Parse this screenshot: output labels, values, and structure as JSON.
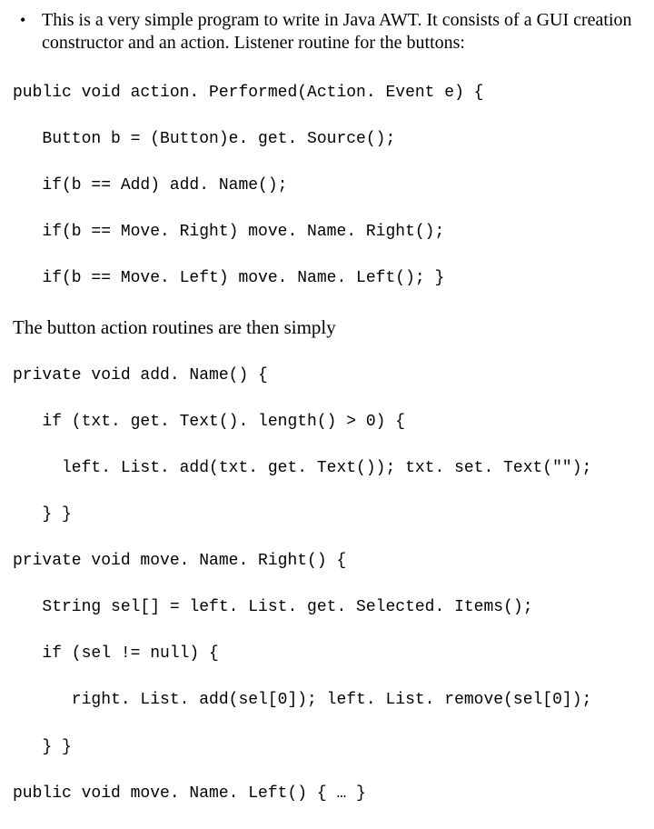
{
  "bullet": {
    "text": "This is a very simple program to write in Java AWT. It consists of a GUI creation constructor and an action. Listener routine for the buttons:"
  },
  "code1": {
    "l1": "public void action. Performed(Action. Event e) {",
    "l2": "   Button b = (Button)e. get. Source();",
    "l3": "   if(b == Add) add. Name();",
    "l4": "   if(b == Move. Right) move. Name. Right();",
    "l5": "   if(b == Move. Left) move. Name. Left(); }"
  },
  "mid": {
    "text": "The button action routines are then simply"
  },
  "code2": {
    "l1": "private void add. Name() {",
    "l2": "   if (txt. get. Text(). length() > 0) {",
    "l3": "     left. List. add(txt. get. Text()); txt. set. Text(\"\");",
    "l4": "   } }",
    "l5": "private void move. Name. Right() {",
    "l6": "   String sel[] = left. List. get. Selected. Items();",
    "l7": "   if (sel != null) {",
    "l8": "      right. List. add(sel[0]); left. List. remove(sel[0]);",
    "l9": "   } }",
    "l10": "public void move. Name. Left() { … }"
  }
}
